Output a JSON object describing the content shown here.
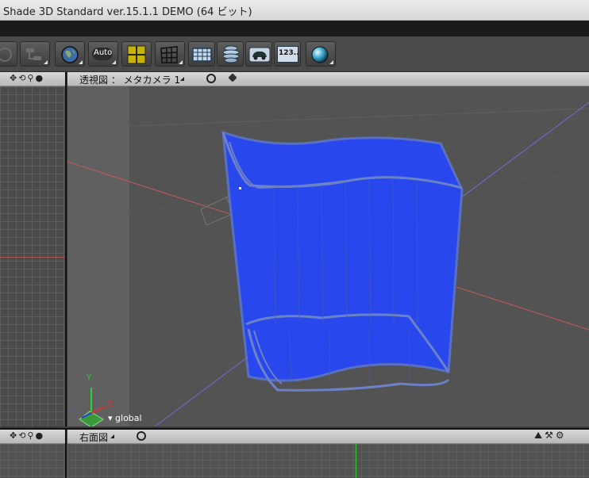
{
  "window": {
    "title": "Shade 3D Standard ver.15.1.1 DEMO (64 ビット)"
  },
  "toolbar": {
    "buttons": [
      {
        "name": "shading-mode-button",
        "icon": "dim-icon"
      },
      {
        "name": "hierarchy-button",
        "icon": "hierarchy-icon"
      },
      {
        "name": "globe-button",
        "icon": "globe-icon"
      },
      {
        "name": "auto-button",
        "icon": "auto-icon",
        "label": "Auto"
      },
      {
        "name": "quad-view-button",
        "icon": "quad-grid-icon"
      },
      {
        "name": "grid-button",
        "icon": "grid-icon"
      },
      {
        "name": "table-button",
        "icon": "table-icon"
      },
      {
        "name": "lathe-button",
        "icon": "lathe-icon"
      },
      {
        "name": "car-button",
        "icon": "car-icon"
      },
      {
        "name": "numeric-button",
        "icon": "numeric-icon",
        "label": "123.."
      },
      {
        "name": "render-button",
        "icon": "sphere-icon"
      }
    ]
  },
  "main_view": {
    "view_label": "透視図 ： メタカメラ 1",
    "axis_y": "Y",
    "axis_x": "X",
    "axis_z": "Z",
    "coord_mode": "global"
  },
  "bottom_view": {
    "view_label": "右面図"
  },
  "colors": {
    "object_fill": "#2848ee",
    "object_outline": "#6c82c8",
    "red_axis": "#c85a5a",
    "blue_axis": "#6e6ed4"
  }
}
